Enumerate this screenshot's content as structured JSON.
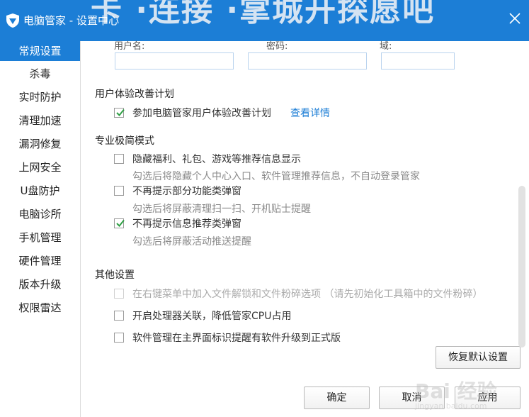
{
  "window": {
    "title": "电脑管家 - 设置中心",
    "background_text": "卡 ·连接  ·掌城开探愿吧",
    "accent_color": "#1c7ed6"
  },
  "sidebar": {
    "items": [
      {
        "label": "常规设置",
        "active": true
      },
      {
        "label": "杀毒"
      },
      {
        "label": "实时防护"
      },
      {
        "label": "清理加速"
      },
      {
        "label": "漏洞修复"
      },
      {
        "label": "上网安全"
      },
      {
        "label": "U盘防护"
      },
      {
        "label": "电脑诊所"
      },
      {
        "label": "手机管理"
      },
      {
        "label": "硬件管理"
      },
      {
        "label": "版本升级"
      },
      {
        "label": "权限雷达"
      }
    ]
  },
  "proxy": {
    "username_label": "用户名:",
    "password_label": "密码:",
    "domain_label": "域:",
    "username_value": "",
    "password_value": "",
    "domain_value": ""
  },
  "ux_plan": {
    "heading": "用户体验改善计划",
    "option": {
      "label": "参加电脑管家用户体验改善计划",
      "checked": true
    },
    "details_link": "查看详情"
  },
  "minimal_mode": {
    "heading": "专业极简模式",
    "options": [
      {
        "label": "隐藏福利、礼包、游戏等推荐信息显示",
        "checked": false,
        "desc": "勾选后将隐藏个人中心入口、软件管理推荐信息，不自动登录管家"
      },
      {
        "label": "不再提示部分功能类弹窗",
        "checked": false,
        "desc": "勾选后将屏蔽清理扫一扫、开机贴士提醒"
      },
      {
        "label": "不再提示信息推荐类弹窗",
        "checked": true,
        "desc": "勾选后将屏蔽活动推送提醒"
      }
    ]
  },
  "other": {
    "heading": "其他设置",
    "options": [
      {
        "label": "在右键菜单中加入文件解锁和文件粉碎选项 （请先初始化工具箱中的文件粉碎）",
        "checked": false,
        "disabled": true
      },
      {
        "label": "开启处理器关联，降低管家CPU占用",
        "checked": false
      },
      {
        "label": "软件管理在主界面标识提醒有软件升级到正式版",
        "checked": false
      }
    ]
  },
  "buttons": {
    "restore_default": "恢复默认设置",
    "ok": "确定",
    "cancel": "取消",
    "apply": "应用"
  },
  "watermark": {
    "text": "Bai 经验",
    "sub": "jingyan.baidu.com"
  }
}
